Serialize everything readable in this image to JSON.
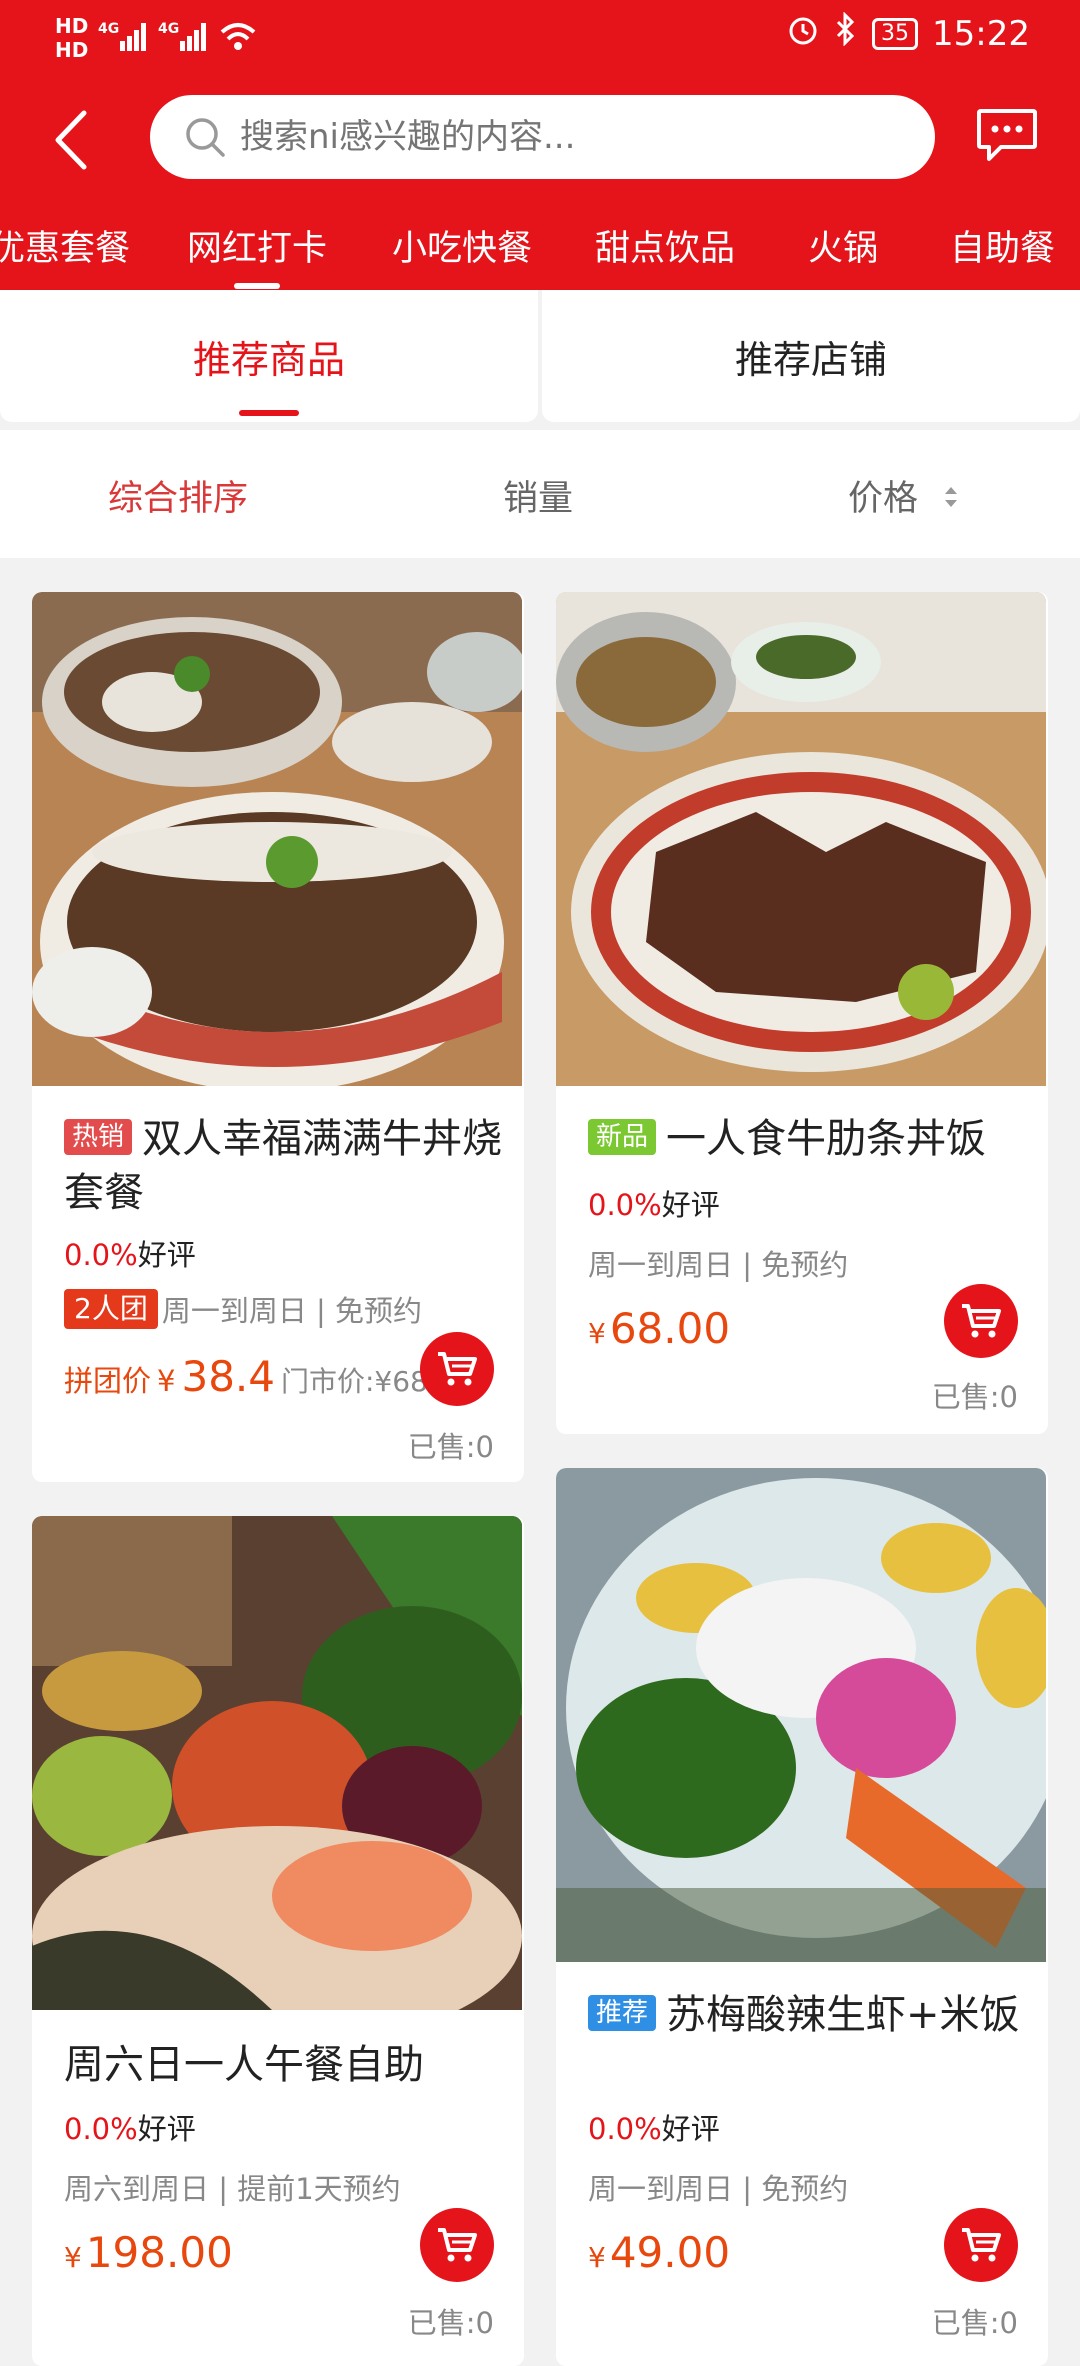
{
  "status": {
    "left_icons": [
      "hd-icon",
      "signal-4g-icon",
      "signal-4g-icon",
      "wifi-icon"
    ],
    "battery": "35",
    "time": "15:22"
  },
  "search": {
    "placeholder": "搜索ni感兴趣的内容..."
  },
  "categories": [
    "优惠套餐",
    "网红打卡",
    "小吃快餐",
    "甜点饮品",
    "火锅",
    "自助餐"
  ],
  "active_category": "网红打卡",
  "tabs": [
    "推荐商品",
    "推荐店铺"
  ],
  "sort": {
    "composite": "综合排序",
    "sales": "销量",
    "price": "价格"
  },
  "colors": {
    "brand_red": "#e5141b",
    "price_orange": "#e8470e",
    "hot_tag": "#e34c4c",
    "new_tag": "#7cc833",
    "rec_tag": "#2e8fe5"
  },
  "products": [
    {
      "tag": "热销",
      "title": "双人幸福满满牛丼烧套餐",
      "rating_pct": "0.0%",
      "rating_label": "好评",
      "group_tag": "2人团",
      "schedule": "周一到周日 | 免预约",
      "group_price_label": "拼团价",
      "yen": "¥",
      "price": "38.4",
      "store_price": "门市价:¥68",
      "sold": "已售:0"
    },
    {
      "tag": "新品",
      "title": "一人食牛肋条丼饭",
      "rating_pct": "0.0%",
      "rating_label": "好评",
      "schedule": "周一到周日 | 免预约",
      "yen": "¥",
      "price": "68.00",
      "sold": "已售:0"
    },
    {
      "title": "周六日一人午餐自助",
      "rating_pct": "0.0%",
      "rating_label": "好评",
      "schedule": "周六到周日 | 提前1天预约",
      "yen": "¥",
      "price": "198.00",
      "sold": "已售:0"
    },
    {
      "tag": "推荐",
      "title": "苏梅酸辣生虾+米饭",
      "rating_pct": "0.0%",
      "rating_label": "好评",
      "schedule": "周一到周日 | 免预约",
      "yen": "¥",
      "price": "49.00",
      "sold": "已售:0"
    }
  ]
}
